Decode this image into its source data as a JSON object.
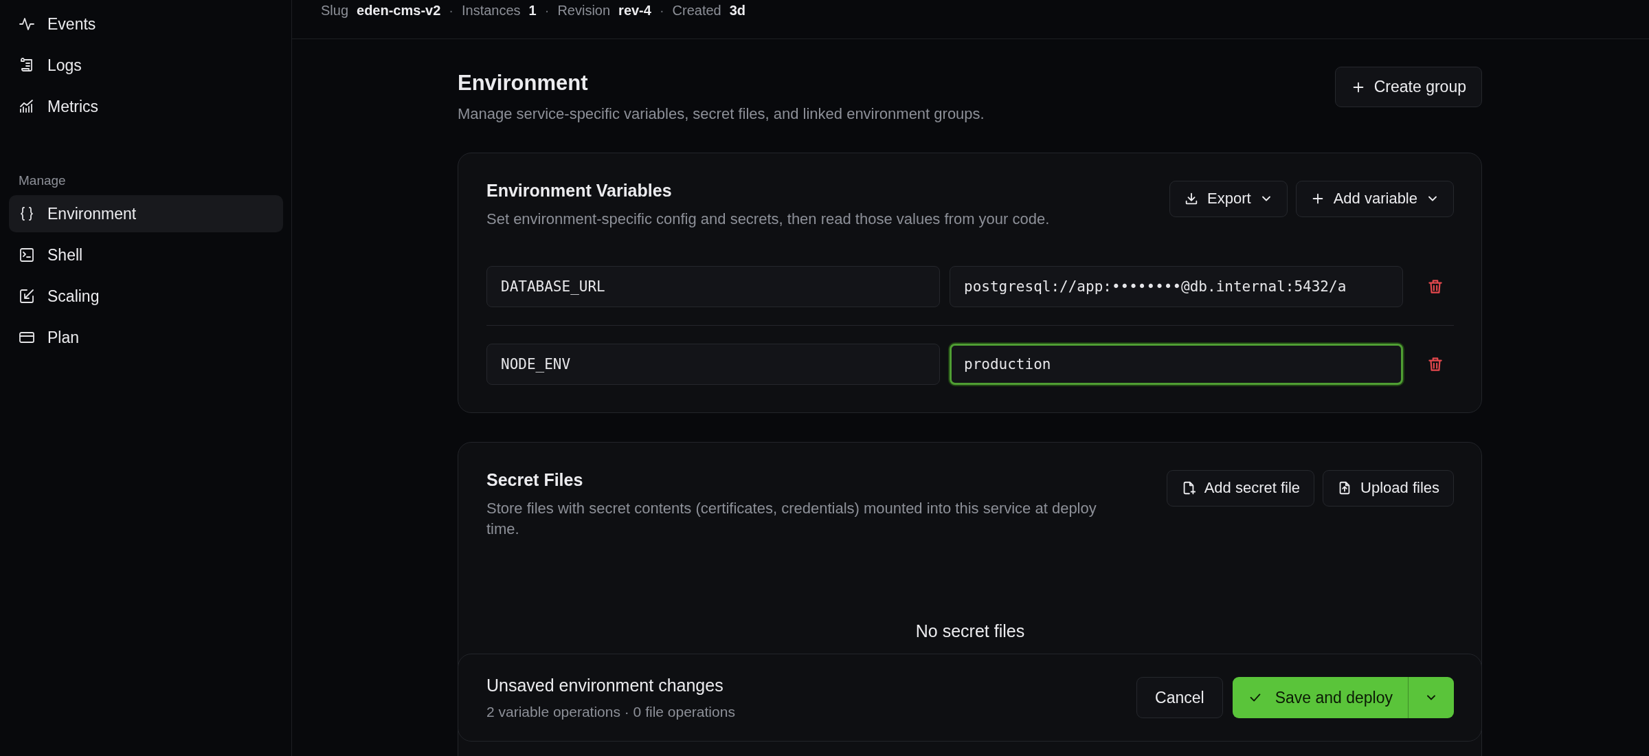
{
  "sidebar": {
    "items": [
      {
        "label": "Events",
        "kind": "pulse",
        "selected": false
      },
      {
        "label": "Logs",
        "kind": "scroll",
        "selected": false
      },
      {
        "label": "Metrics",
        "kind": "chart",
        "selected": false
      }
    ],
    "section": {
      "heading": "Manage",
      "items": [
        {
          "label": "Environment",
          "kind": "braces",
          "selected": true
        },
        {
          "label": "Shell",
          "kind": "terminal",
          "selected": false
        },
        {
          "label": "Scaling",
          "kind": "scale",
          "selected": false
        },
        {
          "label": "Plan",
          "kind": "card",
          "selected": false
        }
      ]
    }
  },
  "meta": [
    {
      "label": "Slug",
      "value": "eden-cms-v2"
    },
    {
      "label": "Instances",
      "value": "1"
    },
    {
      "label": "Revision",
      "value": "rev-4"
    },
    {
      "label": "Created",
      "value": "3d"
    }
  ],
  "meta_separator": "·",
  "page": {
    "title": "Environment",
    "description": "Manage service-specific variables, secret files, and linked environment groups.",
    "action": "Create group"
  },
  "variables": {
    "title": "Environment Variables",
    "description": "Set environment-specific config and secrets, then read those values from your code.",
    "actions": [
      {
        "label": "Export",
        "kind": "download"
      },
      {
        "label": "Add variable",
        "kind": "plus"
      }
    ],
    "rows": [
      {
        "key": "DATABASE_URL",
        "value": "postgresql://app:••••••••@db.internal:5432/a",
        "focused": false
      },
      {
        "key": "NODE_ENV",
        "value": "production",
        "focused": true
      }
    ]
  },
  "secret_files": {
    "title": "Secret Files",
    "description": "Store files with secret contents (certificates, credentials) mounted into this service at deploy time.",
    "actions": [
      {
        "label": "Add secret file",
        "kind": "file-plus"
      },
      {
        "label": "Upload files",
        "kind": "file-upload"
      }
    ],
    "empty_title": "No secret files"
  },
  "unsaved_bar": {
    "title": "Unsaved environment changes",
    "summary": "2 variable operations · 0 file operations",
    "cancel": "Cancel",
    "save": "Save and deploy"
  }
}
